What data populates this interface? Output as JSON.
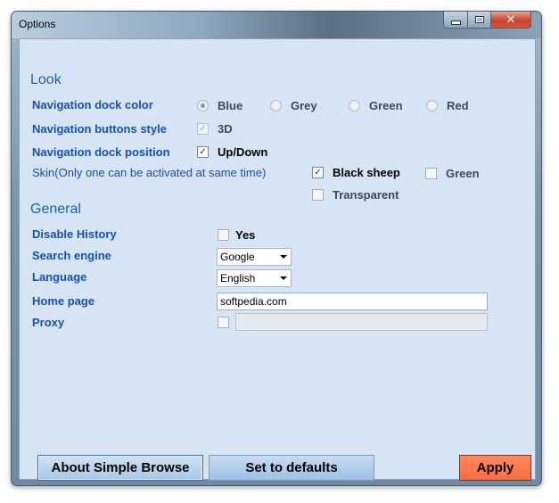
{
  "window": {
    "title": "Options",
    "close_glyph": "✕"
  },
  "look": {
    "heading": "Look",
    "dock_color": {
      "label": "Navigation dock color",
      "options": [
        "Blue",
        "Grey",
        "Green",
        "Red"
      ],
      "selected": "Blue"
    },
    "buttons_style": {
      "label": "Navigation buttons style",
      "option": "3D",
      "checked": true
    },
    "dock_position": {
      "label": "Navigation dock position",
      "option": "Up/Down",
      "checked": true
    },
    "skin": {
      "label": "Skin(Only one can be activated at same time)",
      "options": [
        {
          "label": "Black sheep",
          "checked": true
        },
        {
          "label": "Green",
          "checked": false
        },
        {
          "label": "Transparent",
          "checked": false
        }
      ]
    }
  },
  "general": {
    "heading": "General",
    "history": {
      "label": "Disable History",
      "option": "Yes",
      "checked": false
    },
    "search": {
      "label": "Search engine",
      "value": "Google"
    },
    "language": {
      "label": "Language",
      "value": "English"
    },
    "homepage": {
      "label": "Home page",
      "value": "softpedia.com"
    },
    "proxy": {
      "label": "Proxy",
      "value": "",
      "checked": false
    }
  },
  "buttons": {
    "about": "About Simple Browse",
    "defaults": "Set to defaults",
    "apply": "Apply"
  },
  "icons": {
    "check": "✓",
    "radio": "radio-icon"
  }
}
